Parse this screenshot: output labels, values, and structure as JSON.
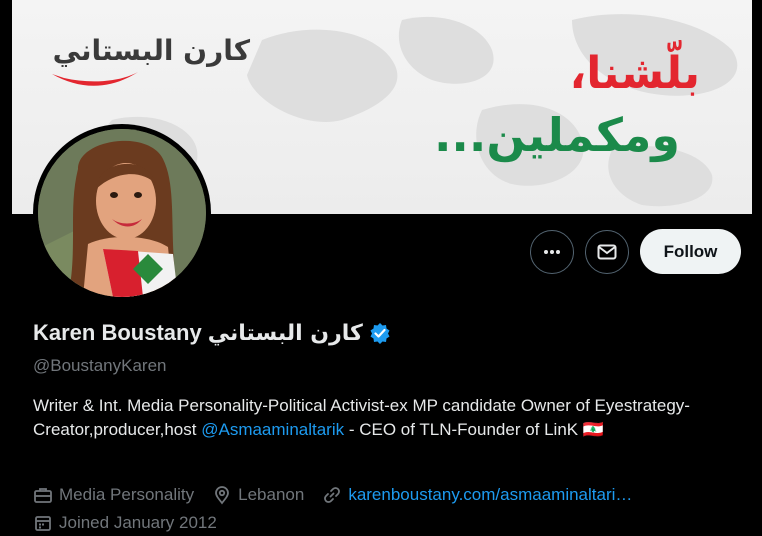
{
  "banner": {
    "logo_text": "كارن البستاني",
    "slogan_line1": "بلّشنا،",
    "slogan_line2": "ومكملين..."
  },
  "profile": {
    "display_name": "Karen Boustany",
    "display_name_arabic": "كارن البستاني",
    "handle": "@BoustanyKaren",
    "verified": true,
    "bio": {
      "part1": "Writer & Int. Media Personality-Political Activist-ex MP candidate Owner of Eyestrategy-Creator,producer,host ",
      "mention": "@Asmaaminaltarik",
      "part2": " - CEO of TLN-Founder of LinK ",
      "flag": "🇱🇧"
    },
    "category": "Media Personality",
    "location": "Lebanon",
    "website": "karenboustany.com/asmaaminaltari…",
    "joined": "Joined January 2012"
  },
  "actions": {
    "follow_label": "Follow"
  },
  "colors": {
    "accent": "#1d9bf0",
    "background": "#000000",
    "follow_bg": "#eff3f4",
    "slogan_red": "#e3262f",
    "slogan_green": "#1b8a4a"
  }
}
